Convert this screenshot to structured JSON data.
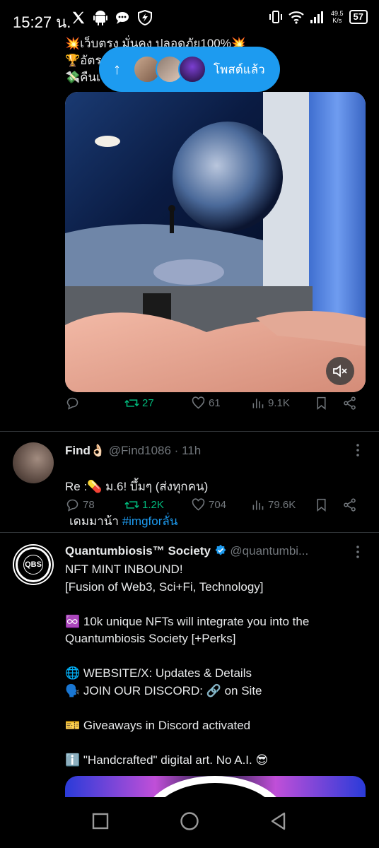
{
  "status_bar": {
    "time": "15:27 น.",
    "net_speed_value": "49.5",
    "net_speed_unit": "K/s",
    "battery": "57",
    "icons": [
      "x-logo-icon",
      "android-icon",
      "chat-icon",
      "shield-bolt-icon",
      "vibrate-icon",
      "wifi-icon",
      "signal-icon"
    ]
  },
  "top_tweet": {
    "text_lines": [
      "💥เว็บตรง มั่นคง ปลอดภัย100%💥",
      "🏆อัตร",
      "💸คืนเ"
    ],
    "stats": {
      "replies": "",
      "reposts": "27",
      "likes": "61",
      "views": "9.1K"
    }
  },
  "posted_pill": {
    "label": "โพสต์แล้ว",
    "arrow": "↑"
  },
  "tweet_find": {
    "name": "Find👌🏻",
    "handle": "@Find1086",
    "separator": "·",
    "time": "11h",
    "line1": "Re :💊 ม.6! บึ้มๆ  (ส่งทุกคน)",
    "line2_prefix": "เดมมาน้า ",
    "hashtag": "#imgforลั่น",
    "stats": {
      "replies": "78",
      "reposts": "1.2K",
      "likes": "704",
      "views": "79.6K"
    }
  },
  "tweet_qbs": {
    "name": "Quantumbiosis™ Society",
    "handle": "@quantumbi...",
    "avatar_text": "QBS",
    "body": "NFT MINT INBOUND!\n[Fusion of Web3, Sci+Fi, Technology]\n\n♾️ 10k unique NFTs will integrate you into the Quantumbiosis Society [+Perks]\n\n🌐 WEBSITE/X: Updates & Details\n🗣️ JOIN OUR DISCORD: 🔗 on Site\n\n🎫 Giveaways in Discord activated\n\nℹ️ \"Handcrafted\" digital art. No A.I. 😎"
  },
  "colors": {
    "background": "#000000",
    "accent": "#1d9bf0",
    "repost_green": "#00ba7c",
    "muted": "#71767b",
    "text": "#e7e9ea"
  }
}
